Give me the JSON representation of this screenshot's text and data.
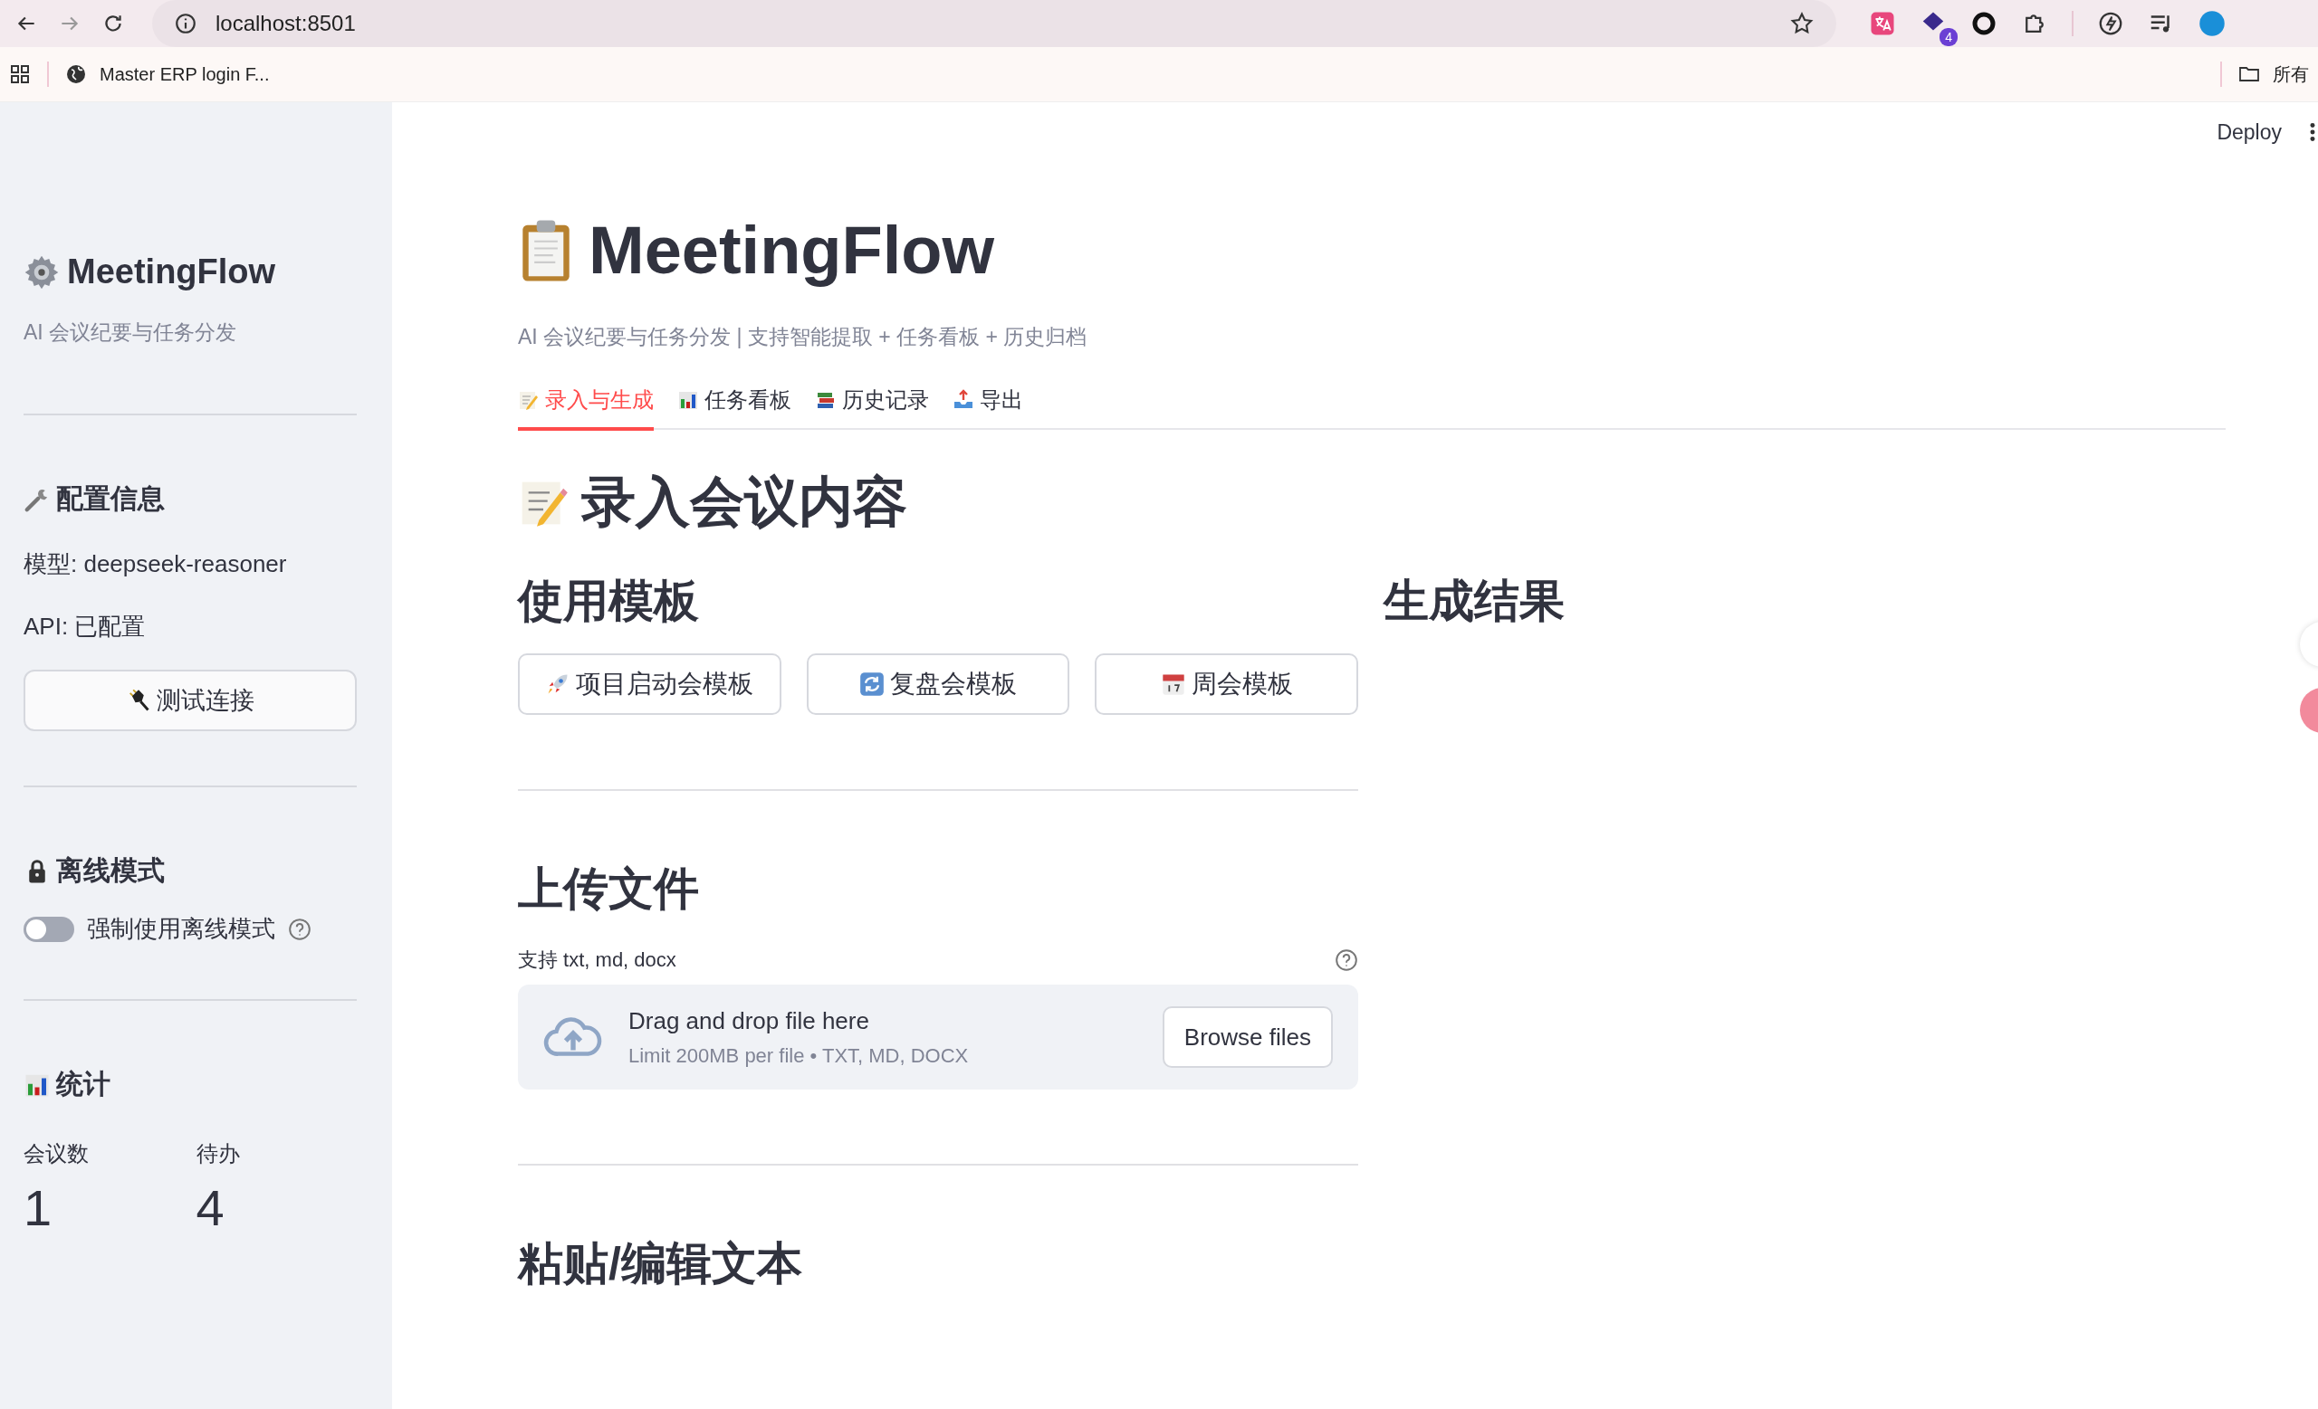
{
  "browser": {
    "url": "localhost:8501",
    "extension_badge": "4",
    "bookmarks": [
      {
        "label": "Master ERP login F..."
      }
    ],
    "bookmarks_folder": "所有"
  },
  "app_header": {
    "deploy": "Deploy"
  },
  "sidebar": {
    "title": "MeetingFlow",
    "subtitle": "AI 会议纪要与任务分发",
    "config": {
      "heading": "配置信息",
      "model": "模型: deepseek-reasoner",
      "api": "API: 已配置",
      "test_button": "测试连接"
    },
    "offline": {
      "heading": "离线模式",
      "toggle": {
        "label": "强制使用离线模式",
        "on": false
      }
    },
    "stats": {
      "heading": "统计",
      "metrics": [
        {
          "label": "会议数",
          "value": "1"
        },
        {
          "label": "待办",
          "value": "4"
        }
      ]
    }
  },
  "main": {
    "title": "MeetingFlow",
    "subtitle": "AI 会议纪要与任务分发 | 支持智能提取 + 任务看板 + 历史归档",
    "tabs": [
      {
        "label": "录入与生成",
        "selected": true
      },
      {
        "label": "任务看板",
        "selected": false
      },
      {
        "label": "历史记录",
        "selected": false
      },
      {
        "label": "导出",
        "selected": false
      }
    ],
    "section_title": "录入会议内容",
    "templates": {
      "heading": "使用模板",
      "buttons": [
        {
          "label": "项目启动会模板"
        },
        {
          "label": "复盘会模板"
        },
        {
          "label": "周会模板"
        }
      ]
    },
    "upload": {
      "heading": "上传文件",
      "label": "支持 txt, md, docx",
      "drop_title": "Drag and drop file here",
      "drop_hint": "Limit 200MB per file • TXT, MD, DOCX",
      "browse_button": "Browse files"
    },
    "paste_heading": "粘贴/编辑文本",
    "result_heading": "生成结果"
  }
}
